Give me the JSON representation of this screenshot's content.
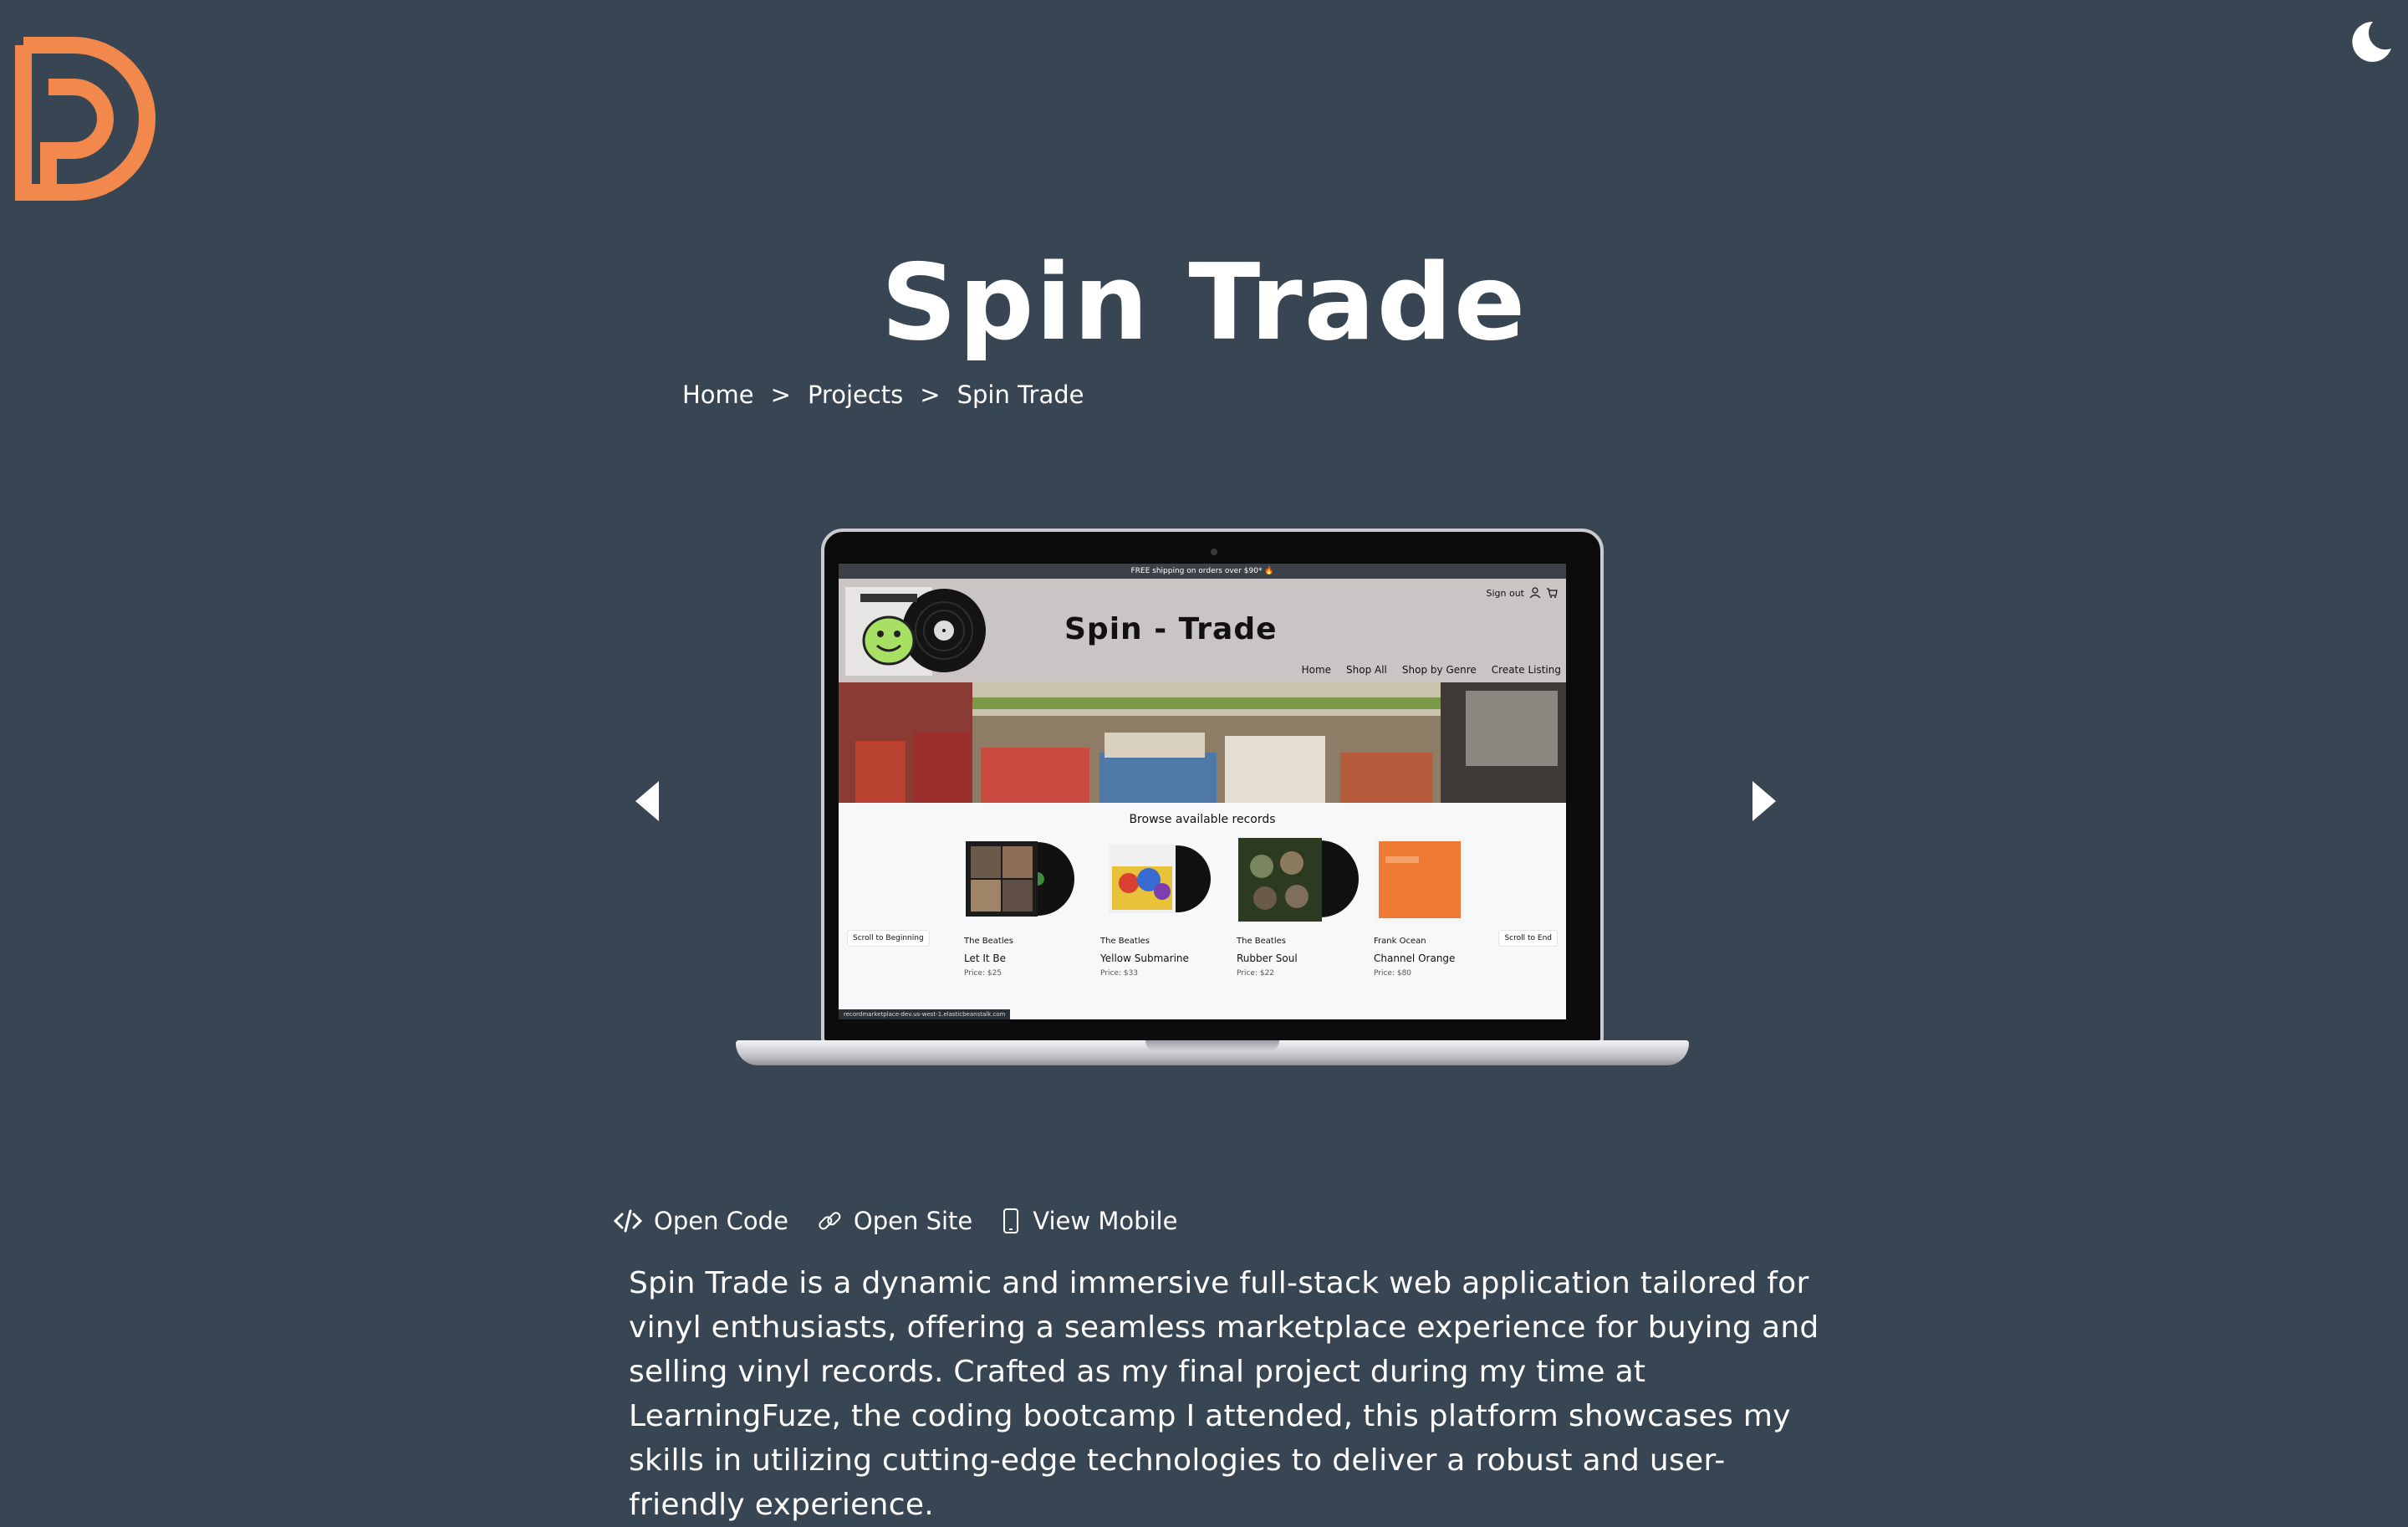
{
  "theme": {
    "background": "#384553",
    "accent": "#f2884b",
    "text": "#ffffff"
  },
  "header": {
    "logo_icon": "dp-monogram-logo",
    "theme_toggle_icon": "moon-icon"
  },
  "page": {
    "title": "Spin Trade"
  },
  "breadcrumb": {
    "items": [
      "Home",
      "Projects",
      "Spin Trade"
    ],
    "separator": ">"
  },
  "carousel": {
    "prev_icon": "triangle-left-icon",
    "next_icon": "triangle-right-icon",
    "slide": {
      "promo": "FREE shipping on orders over $90* 🔥",
      "brand": "Spin - Trade",
      "sign_out": "Sign out",
      "nav": [
        "Home",
        "Shop All",
        "Shop by Genre",
        "Create Listing"
      ],
      "browse_title": "Browse available records",
      "scroll_begin": "Scroll to Beginning",
      "scroll_end": "Scroll to End",
      "status_url": "recordmarketplace-dev.us-west-1.elasticbeanstalk.com",
      "records": [
        {
          "artist": "The Beatles",
          "title": "Let It Be",
          "price": "Price: $25"
        },
        {
          "artist": "The Beatles",
          "title": "Yellow Submarine",
          "price": "Price: $33"
        },
        {
          "artist": "The Beatles",
          "title": "Rubber Soul",
          "price": "Price: $22"
        },
        {
          "artist": "Frank Ocean",
          "title": "Channel Orange",
          "price": "Price: $80"
        }
      ]
    }
  },
  "actions": [
    {
      "label": "Open Code",
      "icon": "code-icon"
    },
    {
      "label": "Open Site",
      "icon": "link-icon"
    },
    {
      "label": "View Mobile",
      "icon": "mobile-phone-icon"
    }
  ],
  "description": "Spin Trade is a dynamic and immersive full-stack web application tailored for vinyl enthusiasts, offering a seamless marketplace experience for buying and selling vinyl records. Crafted as my final project during my time at LearningFuze, the coding bootcamp I attended, this platform showcases my skills in utilizing cutting-edge technologies to deliver a robust and user-friendly experience."
}
